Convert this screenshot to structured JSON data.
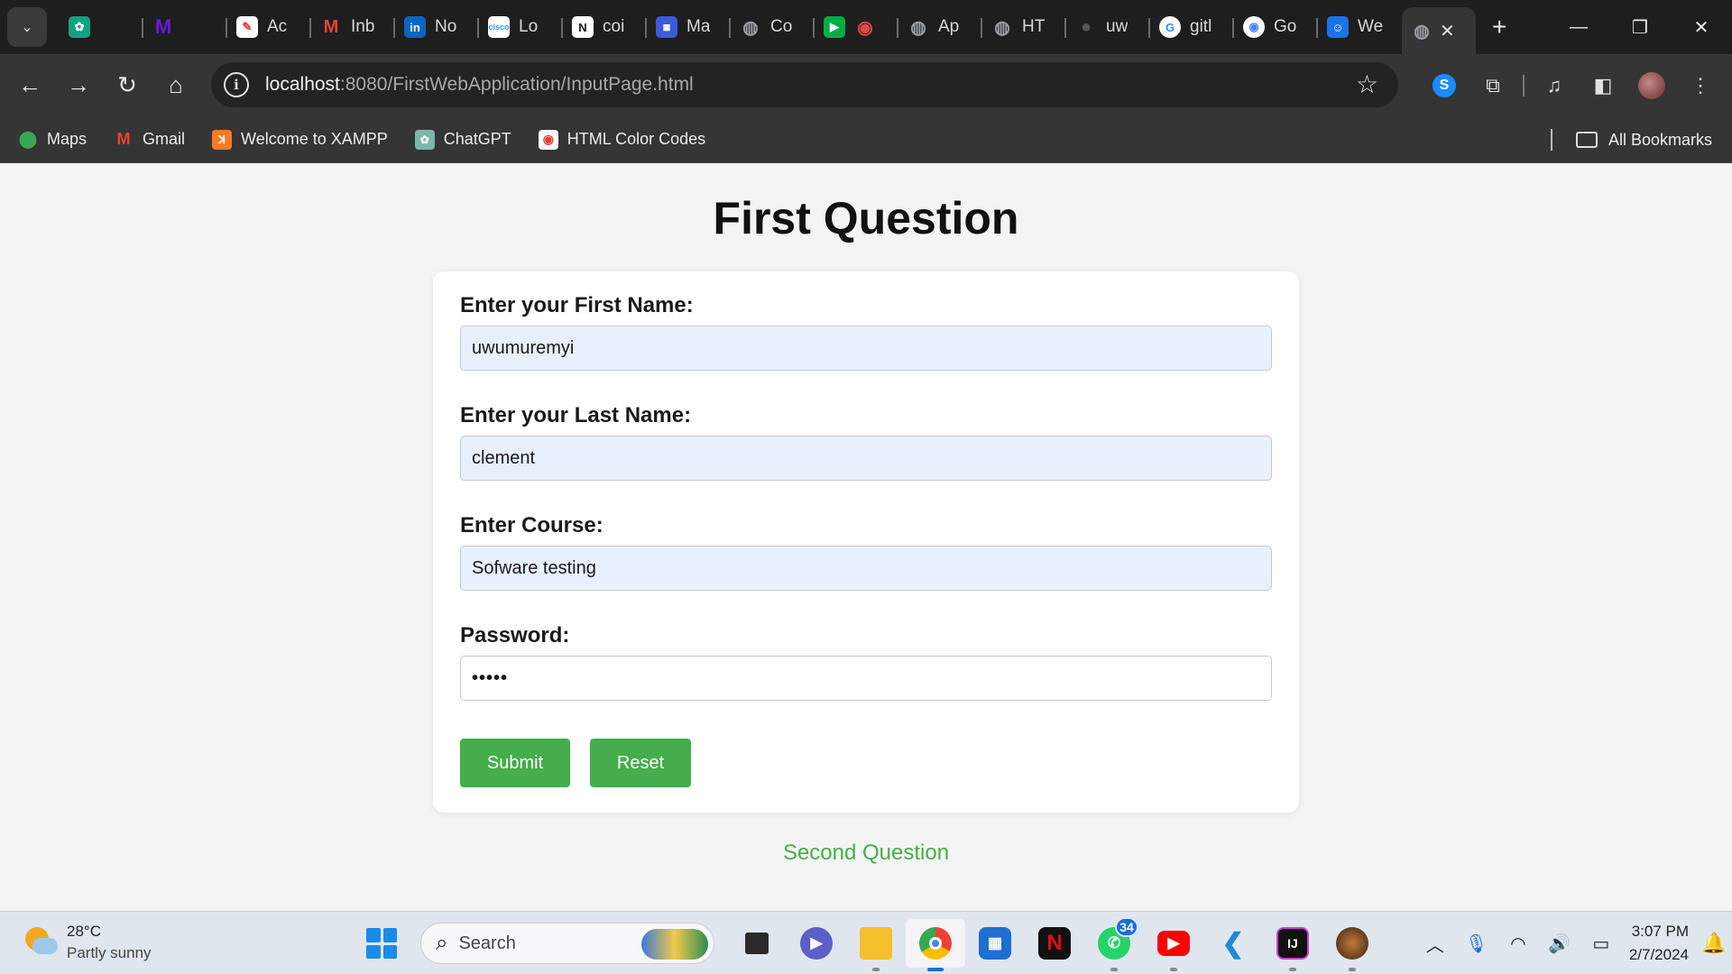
{
  "browser": {
    "tabs": [
      {
        "title": "",
        "icon": "chatgpt-icon",
        "color": "#10a37f"
      },
      {
        "title": "",
        "icon": "m-logo-icon",
        "color": "#6a1bd8"
      },
      {
        "title": "Ac",
        "icon": "acrobat-icon",
        "color": "#e03c31"
      },
      {
        "title": "Inb",
        "icon": "gmail-icon",
        "color": "#ea4335"
      },
      {
        "title": "No",
        "icon": "linkedin-icon",
        "color": "#0a66c2"
      },
      {
        "title": "Lo",
        "icon": "cisco-icon",
        "color": "#1ba0d7"
      },
      {
        "title": "coi",
        "icon": "notion-icon",
        "color": "#ffffff"
      },
      {
        "title": "Ma",
        "icon": "calendar-icon",
        "color": "#3b5bdb"
      },
      {
        "title": "Co",
        "icon": "globe-icon",
        "color": "#9aa0a6"
      },
      {
        "title": "",
        "icon": "meet-icon",
        "color": "#00ac47"
      },
      {
        "title": "Ap",
        "icon": "globe-icon",
        "color": "#9aa0a6"
      },
      {
        "title": "HT",
        "icon": "globe-icon",
        "color": "#9aa0a6"
      },
      {
        "title": "uw",
        "icon": "github-icon",
        "color": "#2b2b2b"
      },
      {
        "title": "gitl",
        "icon": "google-icon",
        "color": "#4285f4"
      },
      {
        "title": "Go",
        "icon": "google-lens-icon",
        "color": "#4285f4"
      },
      {
        "title": "We",
        "icon": "contact-icon",
        "color": "#1a73e8"
      },
      {
        "title": "",
        "icon": "globe-icon",
        "color": "#9aa0a6",
        "active": true
      }
    ],
    "address": {
      "host": "localhost",
      "path": ":8080/FirstWebApplication/InputPage.html"
    },
    "bookmarks": [
      {
        "label": "Maps",
        "icon": "maps-icon"
      },
      {
        "label": "Gmail",
        "icon": "gmail-icon"
      },
      {
        "label": "Welcome to XAMPP",
        "icon": "xampp-icon"
      },
      {
        "label": "ChatGPT",
        "icon": "chatgpt-icon"
      },
      {
        "label": "HTML Color Codes",
        "icon": "color-codes-icon"
      }
    ],
    "all_bookmarks": "All Bookmarks"
  },
  "page": {
    "title": "First Question",
    "form": {
      "first_name_label": "Enter your First Name:",
      "first_name_value": "uwumuremyi",
      "last_name_label": "Enter your Last Name:",
      "last_name_value": "clement",
      "course_label": "Enter Course:",
      "course_value": "Sofware testing",
      "password_label": "Password:",
      "password_value": "•••••",
      "submit_label": "Submit",
      "reset_label": "Reset"
    },
    "second_question_link": "Second Question",
    "accent_color": "#45ad4b"
  },
  "taskbar": {
    "weather_temp": "28°C",
    "weather_cond": "Partly sunny",
    "search_placeholder": "Search",
    "whatsapp_badge": "34",
    "time": "3:07 PM",
    "date": "2/7/2024"
  }
}
